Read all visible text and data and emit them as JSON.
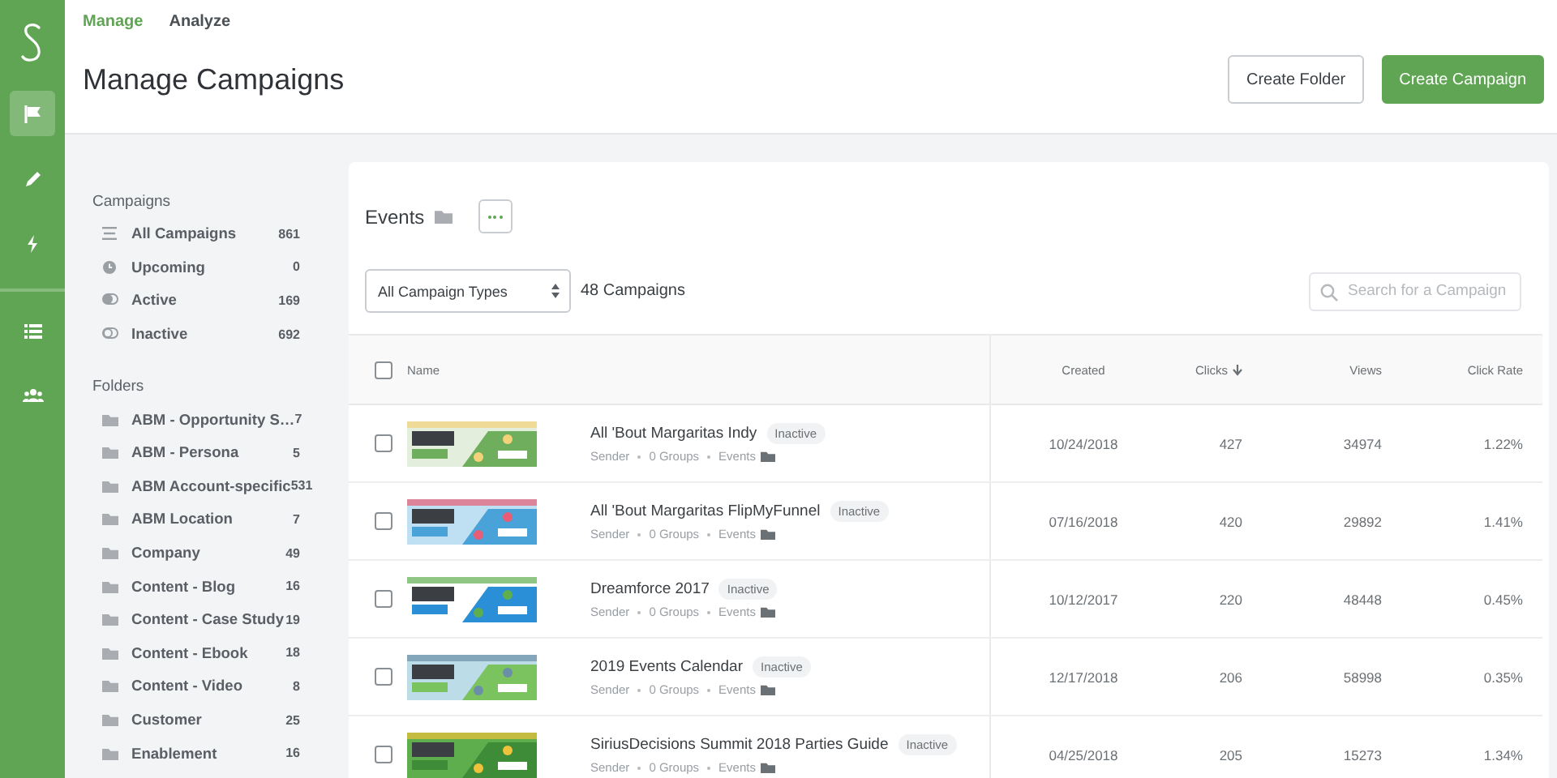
{
  "rail": {
    "items": [
      {
        "kind": "flag",
        "selected": true
      },
      {
        "kind": "pencil",
        "selected": false
      },
      {
        "kind": "bolt",
        "selected": false
      },
      {
        "kind": "list",
        "selected": false
      },
      {
        "kind": "people",
        "selected": false
      }
    ]
  },
  "tabs": [
    {
      "label": "Manage",
      "selected": true
    },
    {
      "label": "Analyze",
      "selected": false
    }
  ],
  "header": {
    "title": "Manage Campaigns",
    "buttons": [
      {
        "label": "Create Folder",
        "kind": "secondary"
      },
      {
        "label": "Create Campaign",
        "kind": "primary"
      }
    ]
  },
  "sidebar": {
    "campaigns_label": "Campaigns",
    "campaigns": [
      {
        "kind": "all",
        "label": "All Campaigns",
        "count": "861"
      },
      {
        "kind": "upcoming",
        "label": "Upcoming",
        "count": "0"
      },
      {
        "kind": "active",
        "label": "Active",
        "count": "169"
      },
      {
        "kind": "inactive",
        "label": "Inactive",
        "count": "692"
      }
    ],
    "folders_label": "Folders",
    "folders": [
      {
        "label": "ABM - Opportunity S…",
        "count": "7"
      },
      {
        "label": "ABM - Persona",
        "count": "5"
      },
      {
        "label": "ABM Account-specific",
        "count": "531"
      },
      {
        "label": "ABM Location",
        "count": "7"
      },
      {
        "label": "Company",
        "count": "49"
      },
      {
        "label": "Content - Blog",
        "count": "16"
      },
      {
        "label": "Content - Case Study",
        "count": "19"
      },
      {
        "label": "Content - Ebook",
        "count": "18"
      },
      {
        "label": "Content - Video",
        "count": "8"
      },
      {
        "label": "Customer",
        "count": "25"
      },
      {
        "label": "Enablement",
        "count": "16"
      }
    ]
  },
  "folder": {
    "title": "Events",
    "type_select": "All Campaign Types",
    "count": "48 Campaigns",
    "search": {
      "placeholder": "Search for a Campaign"
    }
  },
  "table": {
    "all_checked": false,
    "columns": [
      {
        "label": "Name",
        "sorted": false
      },
      {
        "label": "Created",
        "sorted": false
      },
      {
        "label": "Clicks",
        "sorted": true
      },
      {
        "label": "Views",
        "sorted": false
      },
      {
        "label": "Click Rate",
        "sorted": false
      }
    ],
    "rows": [
      {
        "checked": false,
        "name": "All 'Bout Margaritas Indy",
        "status": "Inactive",
        "sender": "Sender",
        "groups": "0 Groups",
        "folder": "Events",
        "created": "10/24/2018",
        "clicks": "427",
        "views": "34974",
        "click_rate": "1.22%"
      },
      {
        "checked": false,
        "name": "All 'Bout Margaritas FlipMyFunnel",
        "status": "Inactive",
        "sender": "Sender",
        "groups": "0 Groups",
        "folder": "Events",
        "created": "07/16/2018",
        "clicks": "420",
        "views": "29892",
        "click_rate": "1.41%"
      },
      {
        "checked": false,
        "name": "Dreamforce 2017",
        "status": "Inactive",
        "sender": "Sender",
        "groups": "0 Groups",
        "folder": "Events",
        "created": "10/12/2017",
        "clicks": "220",
        "views": "48448",
        "click_rate": "0.45%"
      },
      {
        "checked": false,
        "name": "2019 Events Calendar",
        "status": "Inactive",
        "sender": "Sender",
        "groups": "0 Groups",
        "folder": "Events",
        "created": "12/17/2018",
        "clicks": "206",
        "views": "58998",
        "click_rate": "0.35%"
      },
      {
        "checked": false,
        "name": "SiriusDecisions Summit 2018 Parties Guide",
        "status": "Inactive",
        "sender": "Sender",
        "groups": "0 Groups",
        "folder": "Events",
        "created": "04/25/2018",
        "clicks": "205",
        "views": "15273",
        "click_rate": "1.34%"
      }
    ]
  }
}
